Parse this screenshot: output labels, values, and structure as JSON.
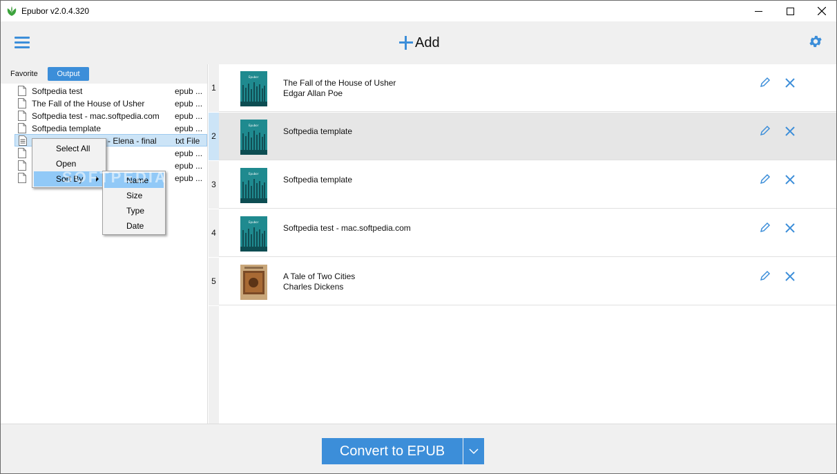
{
  "window": {
    "title": "Epubor v2.0.4.320",
    "controls": [
      "minimize",
      "maximize",
      "close"
    ]
  },
  "toolbar": {
    "menu_icon": "hamburger-icon",
    "add_label": "Add",
    "settings_icon": "gear-icon"
  },
  "left_panel": {
    "tabs": [
      {
        "label": "Favorite",
        "active": false
      },
      {
        "label": "Output",
        "active": true
      }
    ],
    "files": [
      {
        "name": "Softpedia test",
        "type": "epub ..."
      },
      {
        "name": "The Fall of the House of Usher",
        "type": "epub ..."
      },
      {
        "name": "Softpedia test - mac.softpedia.com",
        "type": "epub ..."
      },
      {
        "name": "Softpedia template",
        "type": "epub ..."
      },
      {
        "name": "- Elena - final",
        "type": "txt File",
        "selected": true
      },
      {
        "name": "",
        "type": "epub ..."
      },
      {
        "name": "",
        "type": "epub ..."
      },
      {
        "name": "",
        "type": "epub ..."
      }
    ]
  },
  "context_menu": {
    "items": [
      "Select All",
      "Open",
      "Sort By"
    ],
    "highlighted": "Sort By",
    "submenu": {
      "items": [
        "Name",
        "Size",
        "Type",
        "Date"
      ],
      "highlighted": "Name"
    },
    "watermark": "SOFTPEDIA"
  },
  "books": [
    {
      "index": "1",
      "title": "The Fall of the House of Usher",
      "author": "Edgar Allan Poe",
      "cover": "epubor-cover",
      "selected": false
    },
    {
      "index": "2",
      "title": "Softpedia template",
      "author": "",
      "cover": "epubor-cover",
      "selected": true
    },
    {
      "index": "3",
      "title": "Softpedia template",
      "author": "",
      "cover": "epubor-cover",
      "selected": false
    },
    {
      "index": "4",
      "title": "Softpedia test - mac.softpedia.com",
      "author": "",
      "cover": "epubor-cover",
      "selected": false
    },
    {
      "index": "5",
      "title": "A Tale of Two Cities",
      "author": "Charles Dickens",
      "cover": "painting-cover",
      "selected": false
    }
  ],
  "bottom": {
    "convert_label": "Convert to EPUB",
    "dropdown_icon": "chevron-down-icon"
  },
  "colors": {
    "accent": "#3c8ed9",
    "panel_bg": "#f0f0f0",
    "selected_row": "#e6e6e6",
    "menu_highlight": "#91c9f7",
    "cover_teal": "#1f8a8f"
  }
}
